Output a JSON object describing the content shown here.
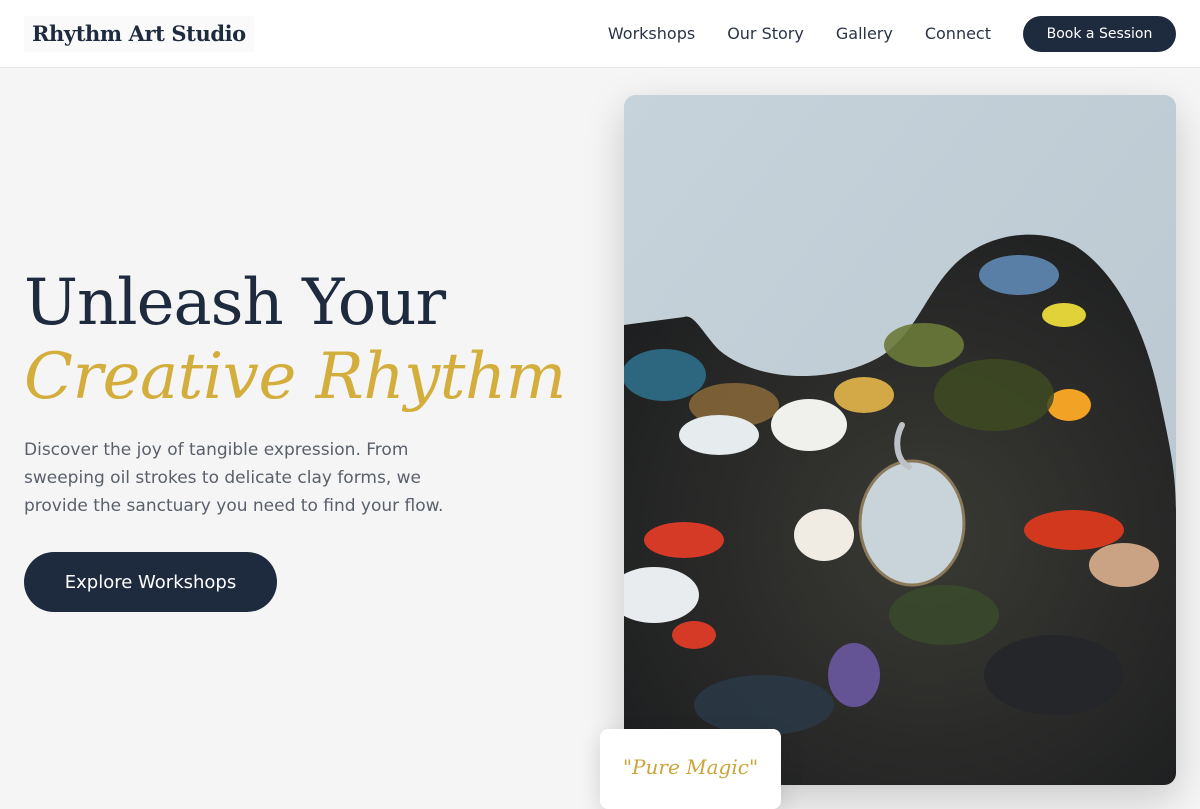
{
  "brand": {
    "name": "Rhythm Art Studio"
  },
  "nav": {
    "links": [
      {
        "label": "Workshops"
      },
      {
        "label": "Our Story"
      },
      {
        "label": "Gallery"
      },
      {
        "label": "Connect"
      }
    ],
    "cta_label": "Book a Session"
  },
  "hero": {
    "title_line1": "Unleash Your",
    "title_line2": "Creative Rhythm",
    "description": "Discover the joy of tangible expression. From sweeping oil strokes to delicate clay forms, we provide the sanctuary you need to find your flow.",
    "cta_label": "Explore Workshops",
    "image_subject": "artist-paint-palette",
    "quote": "\"Pure Magic\""
  },
  "colors": {
    "navy": "#1e2a3e",
    "gold": "#d4ae3c",
    "page_bg": "#f5f5f5",
    "body_text": "#5a606b"
  }
}
